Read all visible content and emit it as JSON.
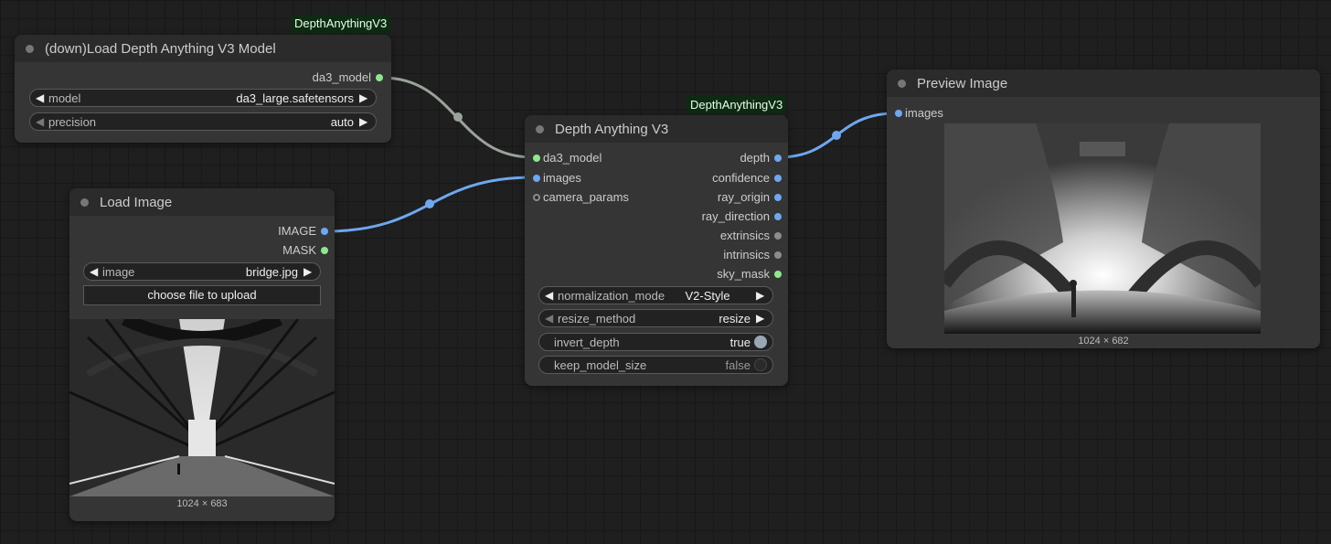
{
  "badges": {
    "loader": "DepthAnythingV3",
    "depth_node": "DepthAnythingV3"
  },
  "loader_node": {
    "title": "(down)Load Depth Anything V3 Model",
    "output": "da3_model",
    "widgets": [
      {
        "label": "model",
        "value": "da3_large.safetensors"
      },
      {
        "label": "precision",
        "value": "auto"
      }
    ]
  },
  "load_image_node": {
    "title": "Load Image",
    "outputs": [
      "IMAGE",
      "MASK"
    ],
    "widget": {
      "label": "image",
      "value": "bridge.jpg"
    },
    "upload_label": "choose file to upload",
    "image_size": "1024 × 683"
  },
  "depth_node": {
    "title": "Depth Anything V3",
    "inputs": [
      "da3_model",
      "images",
      "camera_params"
    ],
    "outputs": [
      "depth",
      "confidence",
      "ray_origin",
      "ray_direction",
      "extrinsics",
      "intrinsics",
      "sky_mask"
    ],
    "widgets": [
      {
        "label": "normalization_mode",
        "value": "V2-Style"
      },
      {
        "label": "resize_method",
        "value": "resize"
      },
      {
        "label": "invert_depth",
        "value": "true"
      },
      {
        "label": "keep_model_size",
        "value": "false"
      }
    ]
  },
  "preview_node": {
    "title": "Preview Image",
    "input": "images",
    "image_size": "1024 × 682"
  },
  "colors": {
    "model_link": "#9aa39a",
    "image_link": "#6ea8f0",
    "badge_bg": "#0e2a12"
  }
}
